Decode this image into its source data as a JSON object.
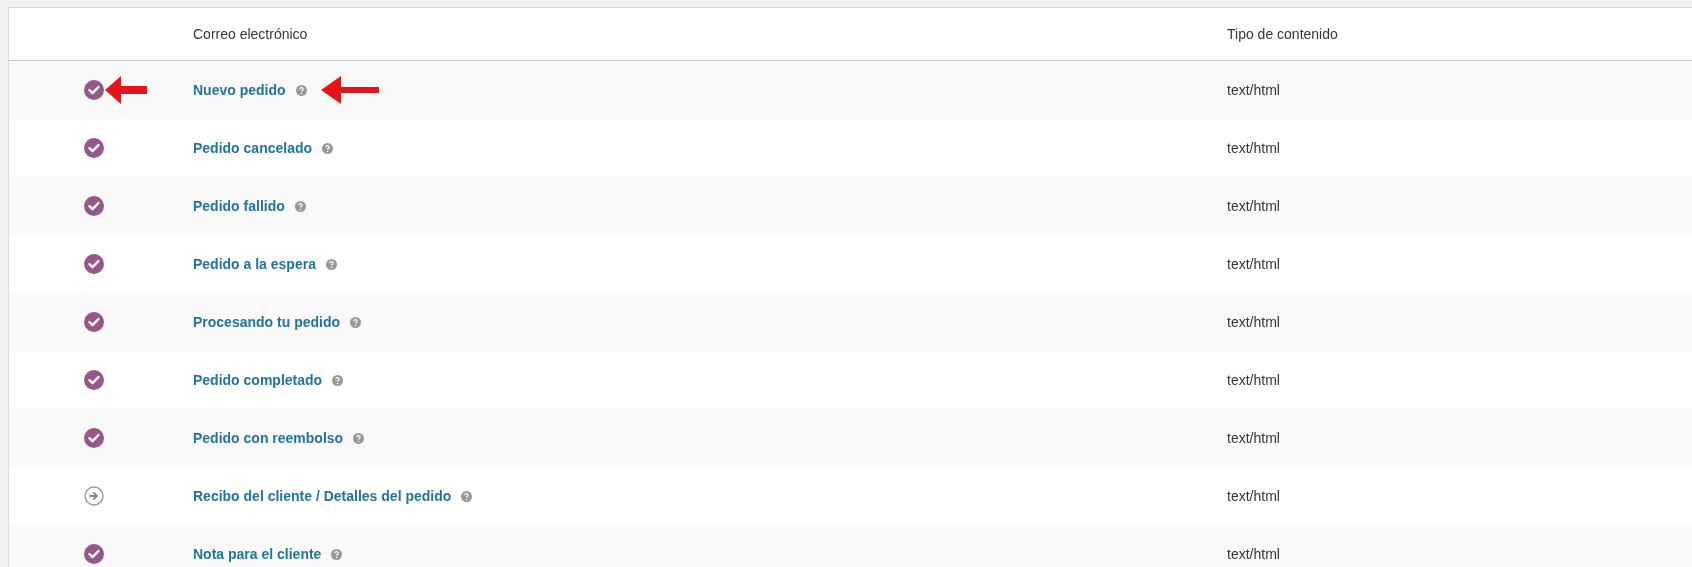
{
  "table": {
    "columns": [
      "Correo electrónico",
      "Tipo de contenido"
    ],
    "rows": [
      {
        "kind": "enabled",
        "email": "Nuevo pedido",
        "content_type": "text/html",
        "annotated": true
      },
      {
        "kind": "enabled",
        "email": "Pedido cancelado",
        "content_type": "text/html",
        "annotated": false
      },
      {
        "kind": "enabled",
        "email": "Pedido fallido",
        "content_type": "text/html",
        "annotated": false
      },
      {
        "kind": "enabled",
        "email": "Pedido a la espera",
        "content_type": "text/html",
        "annotated": false
      },
      {
        "kind": "enabled",
        "email": "Procesando tu pedido",
        "content_type": "text/html",
        "annotated": false
      },
      {
        "kind": "enabled",
        "email": "Pedido completado",
        "content_type": "text/html",
        "annotated": false
      },
      {
        "kind": "enabled",
        "email": "Pedido con reembolso",
        "content_type": "text/html",
        "annotated": false
      },
      {
        "kind": "manual",
        "email": "Recibo del cliente / Detalles del pedido",
        "content_type": "text/html",
        "annotated": false
      },
      {
        "kind": "enabled",
        "email": "Nota para el cliente",
        "content_type": "text/html",
        "annotated": false
      }
    ]
  }
}
